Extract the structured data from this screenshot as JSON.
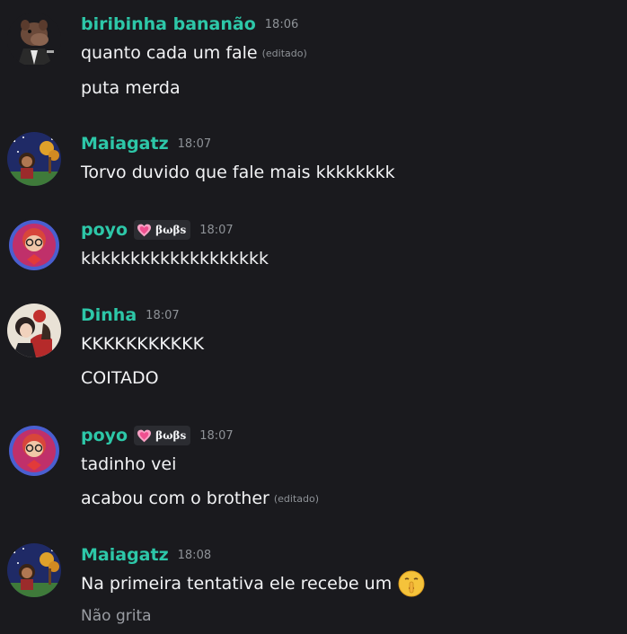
{
  "messages": [
    {
      "username": "biribinha bananão",
      "time": "18:06",
      "lines": [
        {
          "text": "quanto cada um fale",
          "edited": "(editado)"
        },
        {
          "text": "puta merda"
        }
      ]
    },
    {
      "username": "Maiagatz",
      "time": "18:07",
      "lines": [
        {
          "text": "Torvo duvido que fale mais kkkkkkkk"
        }
      ]
    },
    {
      "username": "poyo",
      "tag": "βωβs",
      "time": "18:07",
      "lines": [
        {
          "text": "kkkkkkkkkkkkkkkkkkk"
        }
      ]
    },
    {
      "username": "Dinha",
      "time": "18:07",
      "lines": [
        {
          "text": "KKKKKKKKKKK"
        },
        {
          "text": "COITADO"
        }
      ]
    },
    {
      "username": "poyo",
      "tag": "βωβs",
      "time": "18:07",
      "lines": [
        {
          "text": "tadinho vei"
        },
        {
          "text": "acabou com o brother",
          "edited": "(editado)"
        }
      ]
    },
    {
      "username": "Maiagatz",
      "time": "18:08",
      "lines": [
        {
          "text": "Na primeira tentativa ele recebe um",
          "emoji": "shushing-face"
        },
        {
          "text": "Não grita"
        }
      ]
    }
  ],
  "colors": {
    "background": "#1a1a1e",
    "username": "#2dc7a8",
    "timestamp": "#8e9297",
    "text": "#f2f3f5"
  }
}
